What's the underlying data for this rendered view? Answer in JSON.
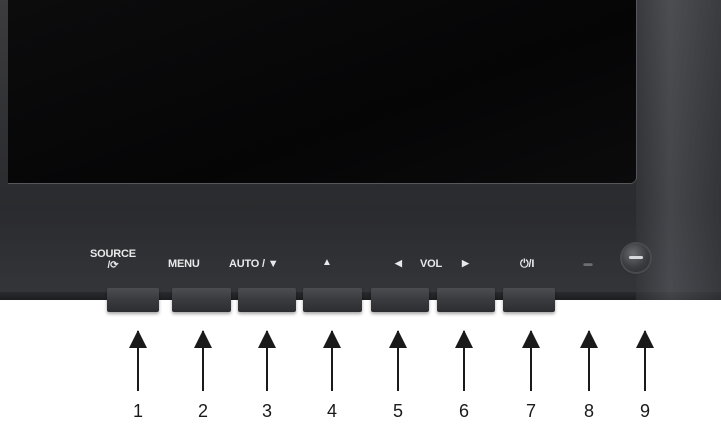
{
  "buttons": {
    "source": "SOURCE",
    "source_sub": "/⟳",
    "menu": "MENU",
    "auto": "AUTO / ▼",
    "up": "▲",
    "vol_left": "◀",
    "vol": "VOL",
    "vol_right": "▶",
    "power": "⏻/I"
  },
  "callouts": [
    "1",
    "2",
    "3",
    "4",
    "5",
    "6",
    "7",
    "8",
    "9"
  ],
  "colors": {
    "bezel": "#2f3033",
    "screen": "#070708",
    "label_text": "#e9e9ea",
    "arrow": "#1a1a1a",
    "background": "#ffffff"
  }
}
